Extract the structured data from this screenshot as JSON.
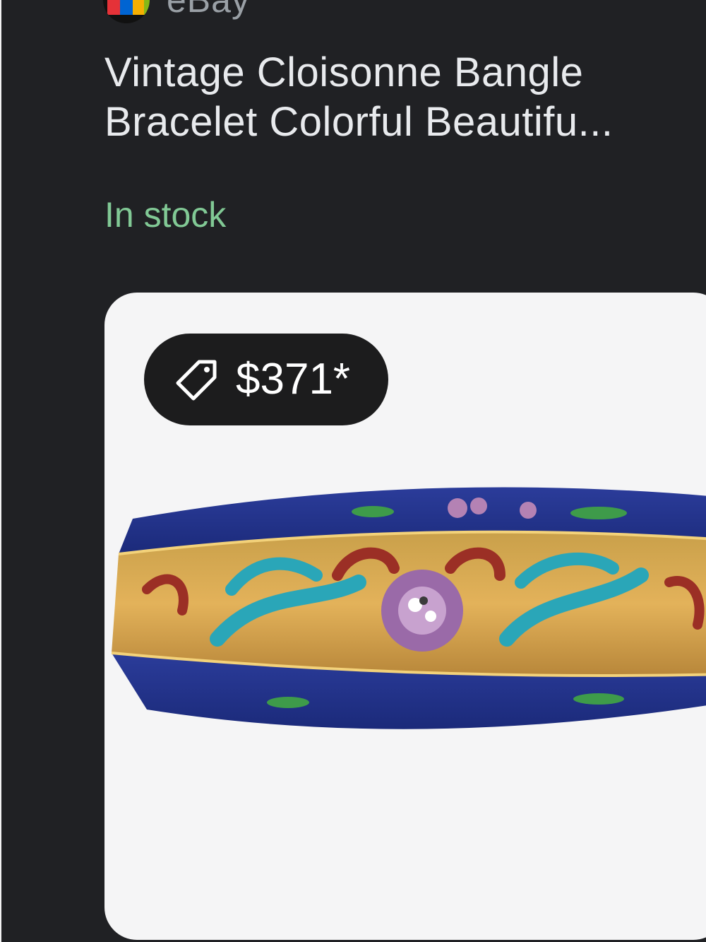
{
  "result": {
    "source": {
      "name": "eBay",
      "favicon_icon": "ebay-favicon-icon"
    },
    "title_lines": [
      "Vintage Cloisonne Bangle",
      "Bracelet Colorful Beautifu..."
    ],
    "availability": "In stock",
    "price": {
      "icon": "price-tag-icon",
      "text": "$371*"
    },
    "image": {
      "subject": "cloisonne-bangle-image"
    }
  },
  "colors": {
    "background": "#202124",
    "title": "#e8eaed",
    "source": "#9aa0a6",
    "in_stock": "#81c995",
    "card": "#f5f5f6",
    "chip": "#1c1c1d"
  }
}
